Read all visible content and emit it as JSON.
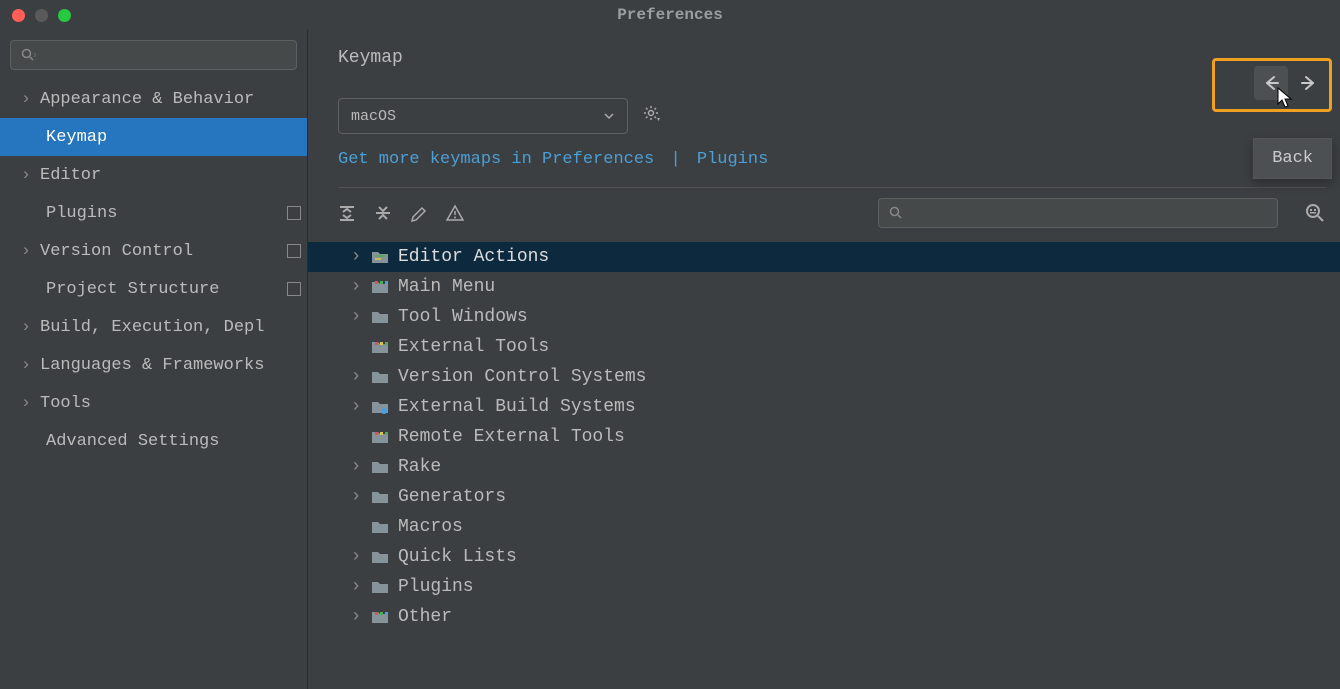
{
  "window": {
    "title": "Preferences"
  },
  "sidebar": {
    "search_placeholder": "",
    "items": [
      {
        "label": "Appearance & Behavior",
        "expandable": true
      },
      {
        "label": "Keymap",
        "expandable": false,
        "selected": true
      },
      {
        "label": "Editor",
        "expandable": true
      },
      {
        "label": "Plugins",
        "expandable": false,
        "badge": true
      },
      {
        "label": "Version Control",
        "expandable": true,
        "badge": true
      },
      {
        "label": "Project Structure",
        "expandable": false,
        "badge": true
      },
      {
        "label": "Build, Execution, Depl",
        "expandable": true
      },
      {
        "label": "Languages & Frameworks",
        "expandable": true
      },
      {
        "label": "Tools",
        "expandable": true
      },
      {
        "label": "Advanced Settings",
        "expandable": false
      }
    ]
  },
  "content": {
    "title": "Keymap",
    "scheme": "macOS",
    "links": {
      "a": "Get more keymaps in Preferences",
      "b": "Plugins"
    },
    "tooltip": "Back",
    "tree": [
      {
        "label": "Editor Actions",
        "selected": true,
        "expandable": true,
        "icon": "special"
      },
      {
        "label": "Main Menu",
        "expandable": true,
        "icon": "menu"
      },
      {
        "label": "Tool Windows",
        "expandable": true,
        "icon": "folder"
      },
      {
        "label": "External Tools",
        "expandable": false,
        "icon": "ext"
      },
      {
        "label": "Version Control Systems",
        "expandable": true,
        "icon": "folder"
      },
      {
        "label": "External Build Systems",
        "expandable": true,
        "icon": "gear-folder"
      },
      {
        "label": "Remote External Tools",
        "expandable": false,
        "icon": "ext"
      },
      {
        "label": "Rake",
        "expandable": true,
        "icon": "folder"
      },
      {
        "label": "Generators",
        "expandable": true,
        "icon": "folder"
      },
      {
        "label": "Macros",
        "expandable": false,
        "icon": "folder"
      },
      {
        "label": "Quick Lists",
        "expandable": true,
        "icon": "folder"
      },
      {
        "label": "Plugins",
        "expandable": true,
        "icon": "folder"
      },
      {
        "label": "Other",
        "expandable": true,
        "icon": "other"
      }
    ]
  }
}
